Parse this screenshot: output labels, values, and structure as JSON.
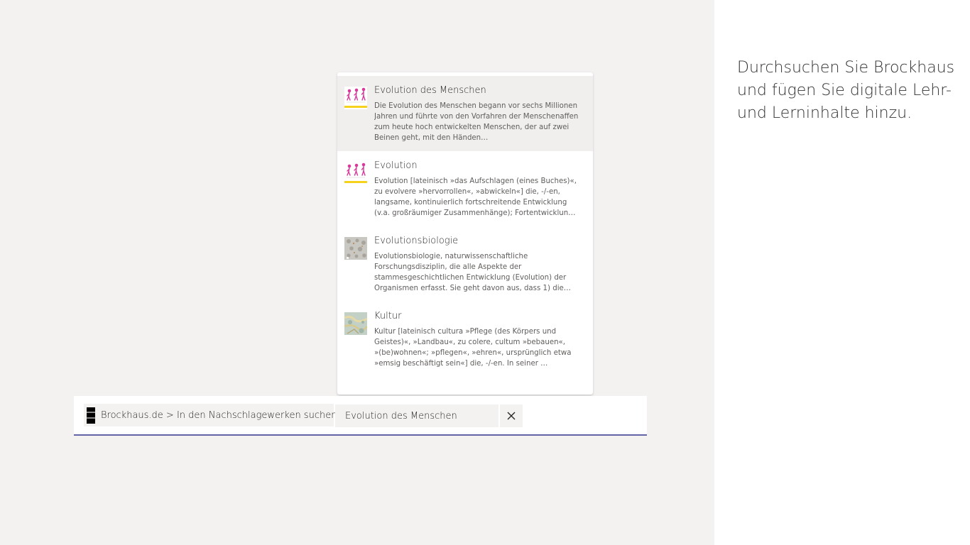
{
  "side_panel": {
    "intro_text": "Durchsuchen Sie Brockhaus und fügen Sie digitale Lehr- und Lerninhalte hinzu."
  },
  "search": {
    "scope_label": "Brockhaus.de > In den Nachschlagewerken suchen.",
    "query": "Evolution des Menschen",
    "clear_icon": "close-icon",
    "underline_color": "#6264a7"
  },
  "results": [
    {
      "title": "Evolution des Menschen",
      "description": "Die Evolution des Menschen begann vor sechs Millionen Jahren und führte von den Vorfahren der Menschenaffen zum heute hoch entwickelten Menschen, der auf zwei Beinen geht, mit den Händen…",
      "thumbnail": "evolution-figures",
      "selected": true
    },
    {
      "title": "Evolution",
      "description": "Evolution [lateinisch »das Aufschlagen (eines Buches)«, zu evolvere »hervorrollen«, »abwickeln«] die, -/-en, langsame, kontinuierlich fortschreitende Entwicklung (v.a. großräumiger Zusammenhänge); Fortentwicklung …",
      "thumbnail": "evolution-figures",
      "selected": false
    },
    {
      "title": "Evolutionsbiologie",
      "description": "Evolutionsbiologie, naturwissenschaftliche Forschungsdisziplin, die alle Aspekte der stammesgeschichtlichen Entwicklung (Evolution) der Organismen erfasst. Sie geht davon aus, dass 1) die…",
      "thumbnail": "specimen-photo",
      "selected": false
    },
    {
      "title": "Kultur",
      "description": "Kultur [lateinisch cultura »Pflege (des Körpers und Geistes)«, »Landbau«, zu colere, cultum »bebauen«, »(be)wohnen«; »pflegen«, »ehren«, ursprünglich etwa »emsig beschäftigt sein«] die, -/-en. In seiner …",
      "thumbnail": "map-photo",
      "selected": false
    }
  ]
}
